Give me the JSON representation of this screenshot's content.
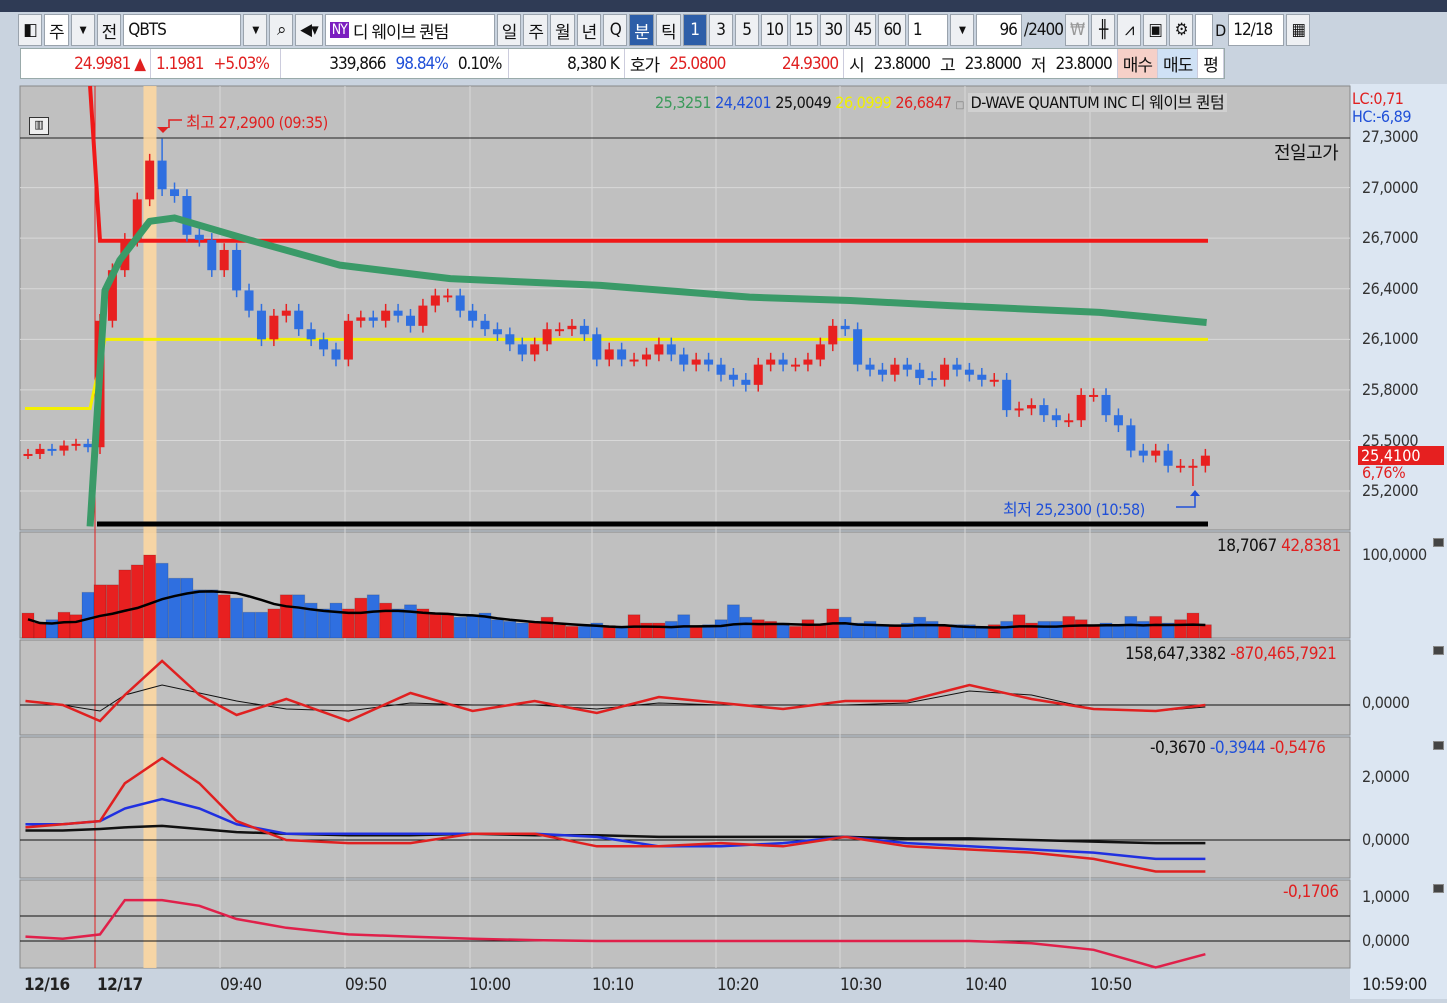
{
  "toolbar": {
    "period_week": "주",
    "prev": "전",
    "symbol": "QBTS",
    "ny_badge": "NY",
    "name": "디 웨이브 퀀텀",
    "periods": [
      "일",
      "주",
      "월",
      "년",
      "Q"
    ],
    "minute": "분",
    "tick": "틱",
    "intervals": [
      "1",
      "3",
      "5",
      "10",
      "15",
      "30",
      "45",
      "60"
    ],
    "active_interval": "1",
    "custom_interval": "1",
    "count": "96",
    "count_max": "/2400",
    "d_label": "D",
    "date": "12/18"
  },
  "quote": {
    "price": "24.9981",
    "arrow": "▲",
    "change": "1.1981",
    "change_pct": "+5.03%",
    "volume": "339,866",
    "vol_ratio": "98.84%",
    "turnover": "0.10%",
    "amount": "8,380 K",
    "hoga_label": "호가",
    "ask": "25.0800",
    "bid": "24.9300",
    "open_label": "시",
    "open": "23.8000",
    "high_label": "고",
    "high": "23.8000",
    "low_label": "저",
    "low": "23.8000",
    "buy": "매수",
    "sell": "매도",
    "avg": "평"
  },
  "legend": {
    "values": [
      {
        "v": "25,3251",
        "color": "#3a9a5a"
      },
      {
        "v": "24,4201",
        "color": "#2050d8"
      },
      {
        "v": "25,0049",
        "color": "#111111"
      },
      {
        "v": "26,0999",
        "color": "#f0f000"
      },
      {
        "v": "26,6847",
        "color": "#e02020"
      }
    ],
    "title": "D-WAVE QUANTUM INC  디 웨이브 퀀텀",
    "lc": "LC:0,71",
    "hc": "HC:-6,89",
    "prev_high_label": "전일고가",
    "max_note": "최고 27,2900 (09:35)",
    "min_note": "최저 25,2300 (10:58)"
  },
  "price_axis": {
    "labels": [
      "27,3000",
      "27,0000",
      "26,7000",
      "26,4000",
      "26,1000",
      "25,8000",
      "25,5000",
      "25,2000"
    ],
    "current": "25,4100",
    "current_pct": "6,76%"
  },
  "panels": {
    "volume": {
      "values": [
        "18,7067",
        "42,8381"
      ],
      "axis": "100,0000"
    },
    "osc1": {
      "values": [
        "158,647,3382",
        "-870,465,7921"
      ],
      "axis": "0,0000"
    },
    "osc2": {
      "values": [
        "-0,3670",
        "-0,3944",
        "-0,5476"
      ],
      "axis": [
        "2,0000",
        "0,0000"
      ]
    },
    "osc3": {
      "values": [
        "-0,1706"
      ],
      "axis": [
        "1,0000",
        "0,0000"
      ]
    }
  },
  "time_axis": {
    "labels": [
      "12/16",
      "12/17",
      "09:40",
      "09:50",
      "10:00",
      "10:10",
      "10:20",
      "10:30",
      "10:40",
      "10:50"
    ],
    "cursor": "10:59:00"
  },
  "chart_data": {
    "type": "candlestick",
    "colors": {
      "up": "#e82020",
      "down": "#2f6fe0"
    },
    "prior_closes": [
      25.42,
      25.45,
      25.44,
      25.47,
      25.48,
      25.46
    ],
    "closes": [
      26.21,
      26.51,
      26.69,
      26.93,
      27.16,
      26.99,
      26.95,
      26.72,
      26.69,
      26.51,
      26.63,
      26.39,
      26.27,
      26.1,
      26.24,
      26.27,
      26.16,
      26.1,
      26.04,
      25.98,
      26.21,
      26.23,
      26.21,
      26.27,
      26.24,
      26.18,
      26.3,
      26.36,
      26.36,
      26.27,
      26.21,
      26.16,
      26.13,
      26.07,
      26.01,
      26.07,
      26.16,
      26.16,
      26.18,
      26.13,
      25.98,
      26.04,
      25.98,
      25.98,
      26.01,
      26.07,
      26.01,
      25.95,
      25.98,
      25.95,
      25.89,
      25.86,
      25.83,
      25.95,
      25.98,
      25.95,
      25.95,
      25.98,
      26.07,
      26.18,
      26.16,
      25.95,
      25.92,
      25.89,
      25.95,
      25.92,
      25.87,
      25.86,
      25.95,
      25.92,
      25.89,
      25.86,
      25.86,
      25.68,
      25.69,
      25.71,
      25.65,
      25.62,
      25.62,
      25.77,
      25.77,
      25.65,
      25.59,
      25.44,
      25.41,
      25.44,
      25.35,
      25.35,
      25.35,
      25.41
    ],
    "high": 27.29,
    "high_index": 5,
    "low": 25.23,
    "low_index": 88,
    "ylim": [
      25.1,
      27.35
    ],
    "lines": {
      "red": {
        "value": 26.6847,
        "color": "#f01818"
      },
      "yellow": {
        "value": 26.0999,
        "prior": 25.69,
        "color": "#f4f000"
      },
      "black": {
        "value": 25.0049,
        "color": "#000000"
      },
      "green": {
        "color": "#3a9a68",
        "points": [
          [
            -0.8,
            24.99
          ],
          [
            0.4,
            26.39
          ],
          [
            1.6,
            26.57
          ],
          [
            4,
            26.8
          ],
          [
            6,
            26.82
          ],
          [
            12,
            26.69
          ],
          [
            19.3,
            26.54
          ],
          [
            28.2,
            26.46
          ],
          [
            40.3,
            26.42
          ],
          [
            52.3,
            26.35
          ],
          [
            60.4,
            26.33
          ],
          [
            68.4,
            26.3
          ],
          [
            80.5,
            26.26
          ],
          [
            89.1,
            26.2
          ]
        ]
      }
    },
    "prior_volume": [
      30,
      18,
      22,
      31,
      28,
      55
    ],
    "volume": [
      64,
      64,
      82,
      88,
      100,
      90,
      72,
      72,
      58,
      58,
      52,
      48,
      31,
      31,
      35,
      52,
      52,
      42,
      35,
      42,
      35,
      48,
      52,
      42,
      35,
      40,
      35,
      30,
      28,
      25,
      28,
      30,
      22,
      20,
      18,
      20,
      25,
      16,
      14,
      14,
      18,
      15,
      14,
      28,
      18,
      18,
      20,
      28,
      14,
      16,
      22,
      40,
      25,
      22,
      20,
      18,
      14,
      22,
      16,
      35,
      25,
      18,
      20,
      16,
      14,
      18,
      25,
      20,
      14,
      16,
      16,
      14,
      16,
      20,
      28,
      18,
      20,
      20,
      26,
      22,
      16,
      18,
      16,
      26,
      20,
      26,
      18,
      22,
      30,
      16
    ],
    "osc_index": [
      -6,
      -3,
      0,
      2,
      5,
      8,
      11,
      15,
      20,
      25,
      30,
      35,
      40,
      45,
      50,
      55,
      60,
      65,
      70,
      75,
      80,
      85,
      89
    ],
    "osc1": {
      "red": [
        0.2,
        0,
        -0.8,
        0.5,
        2.2,
        0.5,
        -0.5,
        0.3,
        -0.8,
        0.6,
        -0.3,
        0.2,
        -0.4,
        0.4,
        0.1,
        -0.2,
        0.2,
        0.2,
        1.0,
        0.3,
        -0.2,
        -0.3,
        0
      ],
      "black": [
        0,
        0,
        -0.3,
        0.5,
        1.0,
        0.6,
        0.2,
        -0.2,
        -0.3,
        0.1,
        0,
        0,
        -0.2,
        0.1,
        0,
        0,
        0,
        0.1,
        0.7,
        0.5,
        -0.2,
        -0.3,
        -0.1
      ]
    },
    "osc2": {
      "red": [
        0.4,
        0.5,
        0.6,
        1.8,
        2.6,
        1.8,
        0.6,
        0,
        -0.1,
        -0.1,
        0.2,
        0.2,
        -0.2,
        -0.2,
        -0.1,
        -0.2,
        0.1,
        -0.2,
        -0.3,
        -0.4,
        -0.6,
        -1.0,
        -1.0
      ],
      "blue": [
        0.5,
        0.5,
        0.6,
        1.0,
        1.3,
        1.0,
        0.5,
        0.2,
        0.2,
        0.2,
        0.2,
        0.2,
        0.1,
        -0.2,
        -0.2,
        -0.1,
        0.1,
        -0.1,
        -0.2,
        -0.3,
        -0.4,
        -0.6,
        -0.6
      ],
      "black": [
        0.3,
        0.3,
        0.35,
        0.4,
        0.45,
        0.35,
        0.25,
        0.2,
        0.15,
        0.15,
        0.2,
        0.15,
        0.15,
        0.1,
        0.1,
        0.1,
        0.1,
        0.05,
        0.05,
        0,
        -0.05,
        -0.1,
        -0.1
      ]
    },
    "osc3": {
      "red": [
        0.1,
        0.05,
        0.15,
        0.93,
        0.93,
        0.8,
        0.5,
        0.3,
        0.15,
        0.1,
        0.05,
        0.02,
        0,
        0,
        0,
        0,
        0,
        0,
        0,
        -0.05,
        -0.2,
        -0.6,
        -0.3
      ]
    }
  }
}
